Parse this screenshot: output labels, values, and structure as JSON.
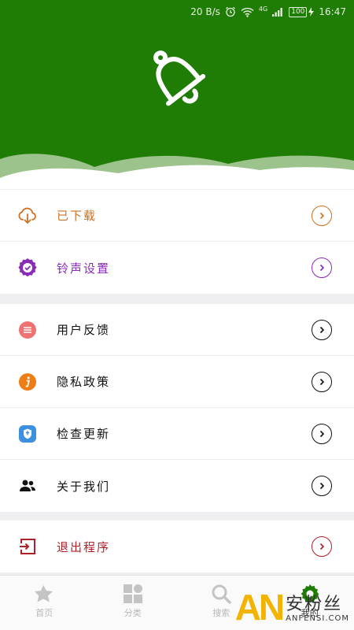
{
  "status_bar": {
    "speed": "20 B/s",
    "network": "4G",
    "battery": "100",
    "time": "16:47",
    "icons": [
      "alarm-icon",
      "wifi-icon",
      "signal-icon",
      "charging-icon"
    ]
  },
  "header": {
    "icon": "bell-icon",
    "bg_color": "#1f7c05"
  },
  "menu_groups": [
    [
      {
        "label": "已下载",
        "icon": "cloud-download-icon",
        "color": "#d07020"
      },
      {
        "label": "铃声设置",
        "icon": "ribbon-check-icon",
        "color": "#8a2bb8"
      }
    ],
    [
      {
        "label": "用户反馈",
        "icon": "feedback-icon",
        "color": "#111111"
      },
      {
        "label": "隐私政策",
        "icon": "info-icon",
        "color": "#111111"
      },
      {
        "label": "检查更新",
        "icon": "update-icon",
        "color": "#111111"
      },
      {
        "label": "关于我们",
        "icon": "people-icon",
        "color": "#111111"
      }
    ],
    [
      {
        "label": "退出程序",
        "icon": "exit-icon",
        "color": "#b02028"
      }
    ]
  ],
  "bottom_nav": [
    {
      "label": "首页",
      "icon": "home-star-icon",
      "active": false
    },
    {
      "label": "分类",
      "icon": "category-icon",
      "active": false
    },
    {
      "label": "搜索",
      "icon": "search-icon",
      "active": false
    },
    {
      "label": "我的",
      "icon": "profile-gear-icon",
      "active": true
    }
  ],
  "watermark": {
    "logo": "AN",
    "cn": "安粉丝",
    "en": "ANFENSI.COM"
  }
}
